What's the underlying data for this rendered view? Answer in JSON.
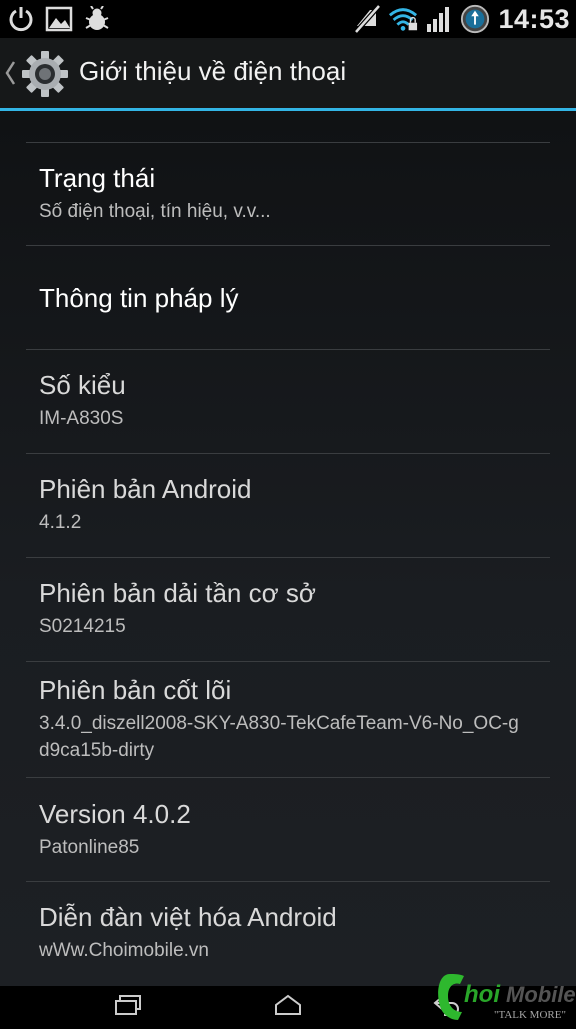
{
  "status_bar": {
    "time": "14:53",
    "left_icons": [
      "power-icon",
      "image-icon",
      "bug-icon"
    ],
    "right_icons": [
      "mute-icon",
      "wifi-icon",
      "signal-icon",
      "sync-icon"
    ]
  },
  "action_bar": {
    "title": "Giới thiệu về điện thoại",
    "accent_color": "#33b5e5"
  },
  "items": [
    {
      "title": "Trạng thái",
      "summary": "Số điện thoại, tín hiệu, v.v..."
    },
    {
      "title": "Thông tin pháp lý",
      "summary": ""
    },
    {
      "title": "Số kiểu",
      "summary": "IM-A830S"
    },
    {
      "title": "Phiên bản Android",
      "summary": "4.1.2"
    },
    {
      "title": "Phiên bản dải tần cơ sở",
      "summary": "S0214215"
    },
    {
      "title": "Phiên bản cốt lõi",
      "summary": "3.4.0_diszell2008-SKY-A830-TekCafeTeam-V6-No_OC-gd9ca15b-dirty"
    },
    {
      "title": "Version 4.0.2",
      "summary": "Patonline85"
    },
    {
      "title": "Diễn đàn việt hóa Android",
      "summary": "wWw.Choimobile.vn"
    }
  ],
  "nav_bar": {
    "buttons": [
      "recent-apps-icon",
      "home-icon",
      "back-icon"
    ]
  },
  "watermark": {
    "brand": "ChoiMobile",
    "tagline": "\"TALK MORE\""
  }
}
